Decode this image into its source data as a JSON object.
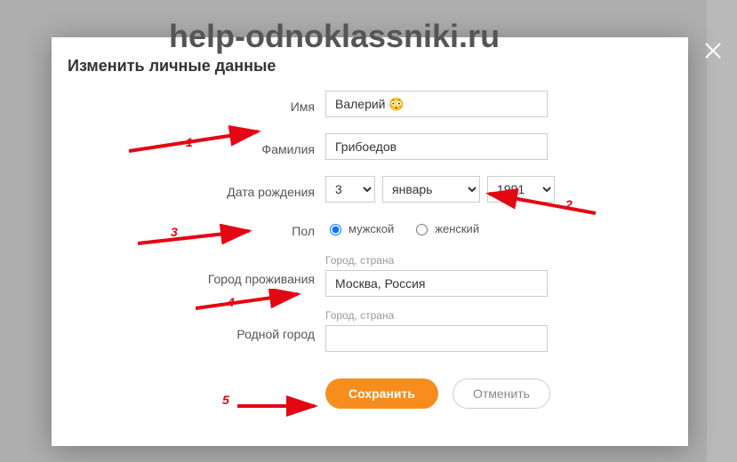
{
  "watermark": "help-odnoklassniki.ru",
  "modal": {
    "title": "Изменить личные данные",
    "labels": {
      "name": "Имя",
      "surname": "Фамилия",
      "birthdate": "Дата рождения",
      "gender": "Пол",
      "city_live": "Город проживания",
      "city_home": "Родной город",
      "city_sublabel": "Город, страна"
    },
    "values": {
      "name": "Валерий 😳",
      "surname": "Грибоедов",
      "day": "3",
      "month": "январь",
      "year": "1991",
      "gender_male": "мужской",
      "gender_female": "женский",
      "city_live": "Москва, Россия",
      "city_home": ""
    },
    "buttons": {
      "save": "Сохранить",
      "cancel": "Отменить"
    }
  },
  "annotations": {
    "n1": "1",
    "n2": "2",
    "n3": "3",
    "n4": "4",
    "n5": "5"
  }
}
